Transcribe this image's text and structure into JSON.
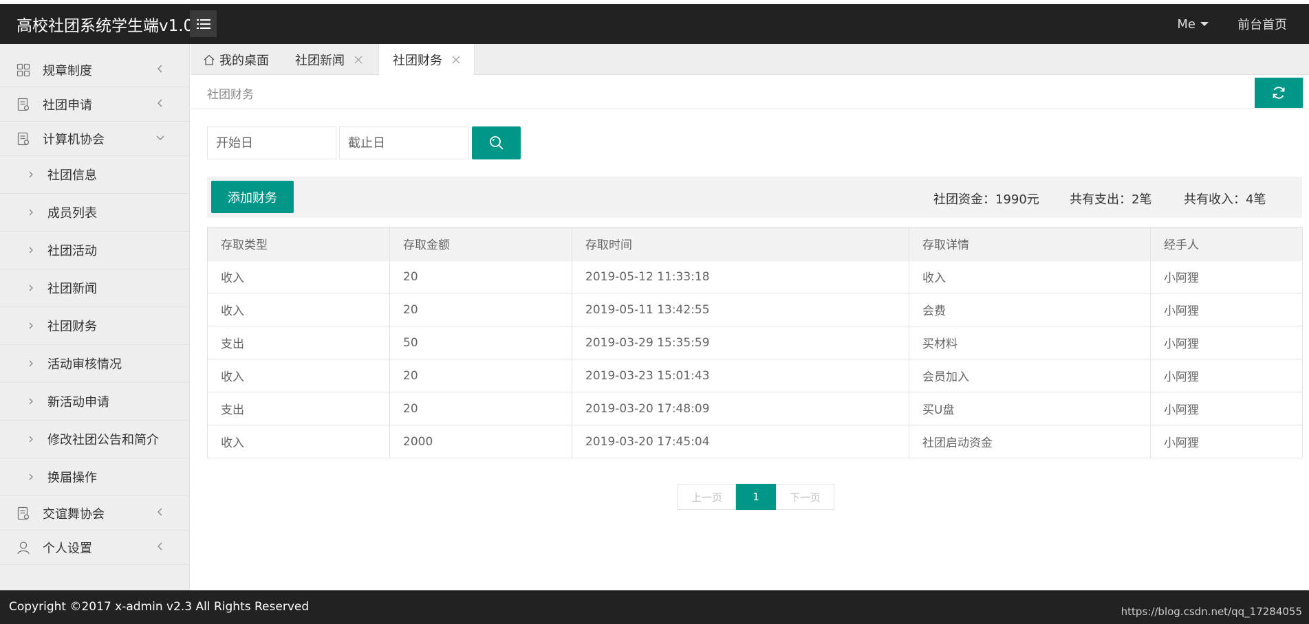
{
  "header": {
    "app_title": "高校社团系统学生端v1.0",
    "user_menu": "Me",
    "home_link": "前台首页"
  },
  "sidebar": {
    "groups": [
      {
        "label": "规章制度",
        "icon": "grid-icon",
        "expanded": false
      },
      {
        "label": "社团申请",
        "icon": "document-icon",
        "expanded": false
      },
      {
        "label": "计算机协会",
        "icon": "document-icon",
        "expanded": true,
        "items": [
          "社团信息",
          "成员列表",
          "社团活动",
          "社团新闻",
          "社团财务",
          "活动审核情况",
          "新活动申请",
          "修改社团公告和简介",
          "换届操作"
        ]
      },
      {
        "label": "交谊舞协会",
        "icon": "document-icon",
        "expanded": false
      },
      {
        "label": "个人设置",
        "icon": "user-icon",
        "expanded": false
      }
    ]
  },
  "tabs": [
    {
      "label": "我的桌面",
      "closable": false,
      "active": false
    },
    {
      "label": "社团新闻",
      "closable": true,
      "active": false
    },
    {
      "label": "社团财务",
      "closable": true,
      "active": true
    }
  ],
  "breadcrumb": "社团财务",
  "search": {
    "start_placeholder": "开始日",
    "end_placeholder": "截止日"
  },
  "toolbar": {
    "add_label": "添加财务",
    "funds": "社团资金：1990元",
    "expense_count": "共有支出：2笔",
    "income_count": "共有收入：4笔"
  },
  "table": {
    "columns": [
      "存取类型",
      "存取金额",
      "存取时间",
      "存取详情",
      "经手人"
    ],
    "rows": [
      [
        "收入",
        "20",
        "2019-05-12 11:33:18",
        "收入",
        "小阿狸"
      ],
      [
        "收入",
        "20",
        "2019-05-11 13:42:55",
        "会费",
        "小阿狸"
      ],
      [
        "支出",
        "50",
        "2019-03-29 15:35:59",
        "买材料",
        "小阿狸"
      ],
      [
        "收入",
        "20",
        "2019-03-23 15:01:43",
        "会员加入",
        "小阿狸"
      ],
      [
        "支出",
        "20",
        "2019-03-20 17:48:09",
        "买U盘",
        "小阿狸"
      ],
      [
        "收入",
        "2000",
        "2019-03-20 17:45:04",
        "社团启动资金",
        "小阿狸"
      ]
    ]
  },
  "pagination": {
    "prev": "上一页",
    "current": "1",
    "next": "下一页"
  },
  "footer": {
    "copyright": "Copyright ©2017 x-admin v2.3 All Rights Reserved",
    "watermark": "https://blog.csdn.net/qq_17284055"
  },
  "colors": {
    "accent": "#009688",
    "header_bg": "#222222",
    "sidebar_bg": "#eeeeee"
  }
}
